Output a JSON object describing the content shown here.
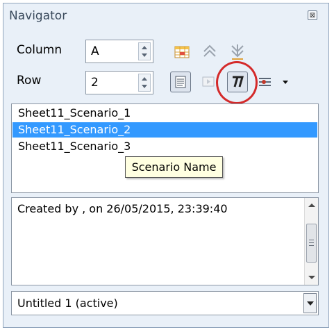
{
  "window": {
    "title": "Navigator",
    "close_glyph": "⊠"
  },
  "fields": {
    "column_label": "Column",
    "column_value": "A",
    "row_label": "Row",
    "row_value": "2"
  },
  "toolbar": {
    "icons": [
      "data-range-icon",
      "start-icon",
      "end-icon",
      "contents-icon",
      "toggle-icon",
      "scenarios-icon",
      "drag-mode-icon",
      "dropdown-arrow-icon"
    ],
    "pressed": [
      "contents-icon",
      "scenarios-icon"
    ]
  },
  "scenarios": {
    "items": [
      "Sheet11_Scenario_1",
      "Sheet11_Scenario_2",
      "Sheet11_Scenario_3"
    ],
    "selected_index": 1,
    "tooltip": "Scenario Name"
  },
  "comment": {
    "text": "Created by  , on 26/05/2015, 23:39:40"
  },
  "document_select": {
    "value": "Untitled 1 (active)"
  },
  "colors": {
    "selection": "#3399ff",
    "highlight_circle": "#d42a2a",
    "tooltip_bg": "#ffffe1",
    "panel_bg": "#e9f0f8"
  }
}
